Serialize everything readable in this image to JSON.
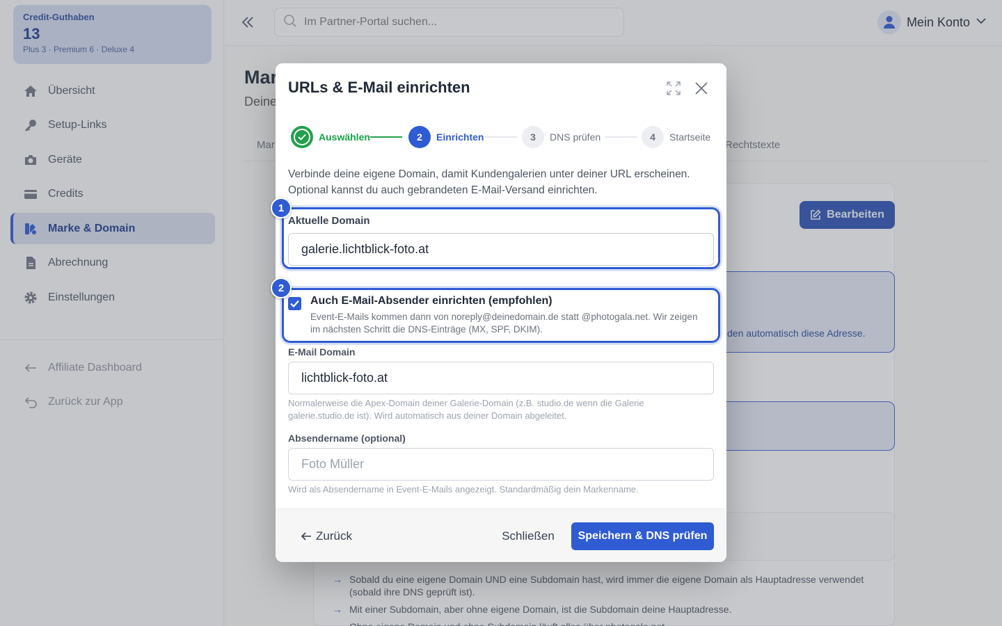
{
  "sidebar": {
    "credit": {
      "label": "Credit-Guthaben",
      "count": "13",
      "breakdown": "Plus 3 · Premium 6 · Deluxe 4"
    },
    "items": [
      {
        "label": "Übersicht",
        "icon": "home-icon"
      },
      {
        "label": "Setup-Links",
        "icon": "key-icon"
      },
      {
        "label": "Geräte",
        "icon": "camera-icon"
      },
      {
        "label": "Credits",
        "icon": "card-icon"
      },
      {
        "label": "Marke & Domain",
        "icon": "brand-icon",
        "active": true
      },
      {
        "label": "Abrechnung",
        "icon": "document-icon"
      },
      {
        "label": "Einstellungen",
        "icon": "gear-icon"
      }
    ],
    "secondary": [
      {
        "label": "Affiliate Dashboard",
        "icon": "arrow-left-icon"
      },
      {
        "label": "Zurück zur App",
        "icon": "return-icon"
      }
    ]
  },
  "topbar": {
    "search_placeholder": "Im Partner-Portal suchen...",
    "account_label": "Mein Konto"
  },
  "page": {
    "title_fragment": "Mar",
    "subtitle_fragment": "Deine",
    "tab_fragment_left": "Mar",
    "tab_fragment_right": "Rechtstexte",
    "edit_label": "Bearbeiten",
    "info_fragment": "den automatisch diese Adresse.",
    "bullets": [
      "Sobald du eine eigene Domain UND eine Subdomain hast, wird immer die eigene Domain als Hauptadresse verwendet (sobald ihre DNS geprüft ist).",
      "Mit einer Subdomain, aber ohne eigene Domain, ist die Subdomain deine Hauptadresse.",
      "Ohne eigene Domain und ohne Subdomain läuft alles über photogala.net"
    ]
  },
  "modal": {
    "title": "URLs & E-Mail einrichten",
    "steps": [
      {
        "number": "1",
        "label": "Auswählen",
        "state": "done"
      },
      {
        "number": "2",
        "label": "Einrichten",
        "state": "active"
      },
      {
        "number": "3",
        "label": "DNS prüfen",
        "state": "todo"
      },
      {
        "number": "4",
        "label": "Startseite",
        "state": "todo"
      }
    ],
    "intro": "Verbinde deine eigene Domain, damit Kundengalerien unter deiner URL erscheinen. Optional kannst du auch gebrandeten E-Mail-Versand einrichten.",
    "badges": [
      "1",
      "2"
    ],
    "domain": {
      "label": "Aktuelle Domain",
      "value": "galerie.lichtblick-foto.at"
    },
    "email_checkbox": {
      "checked": true,
      "label": "Auch E-Mail-Absender einrichten (empfohlen)",
      "description": "Event-E-Mails kommen dann von noreply@deinedomain.de statt @photogala.net. Wir zeigen im nächsten Schritt die DNS-Einträge (MX, SPF, DKIM)."
    },
    "email_domain": {
      "label": "E-Mail Domain",
      "value": "lichtblick-foto.at",
      "help": "Normalerweise die Apex-Domain deiner Galerie-Domain (z.B. studio.de wenn die Galerie galerie.studio.de ist). Wird automatisch aus deiner Domain abgeleitet."
    },
    "sender_name": {
      "label": "Absendername (optional)",
      "placeholder": "Foto Müller",
      "help": "Wird als Absendername in Event-E-Mails angezeigt. Standardmäßig dein Markenname."
    },
    "footer": {
      "back_label": "Zurück",
      "close_label": "Schließen",
      "save_label": "Speichern & DNS prüfen"
    }
  },
  "colors": {
    "accent": "#2f5bd3",
    "success": "#22a04b",
    "text": "#1f2937"
  }
}
